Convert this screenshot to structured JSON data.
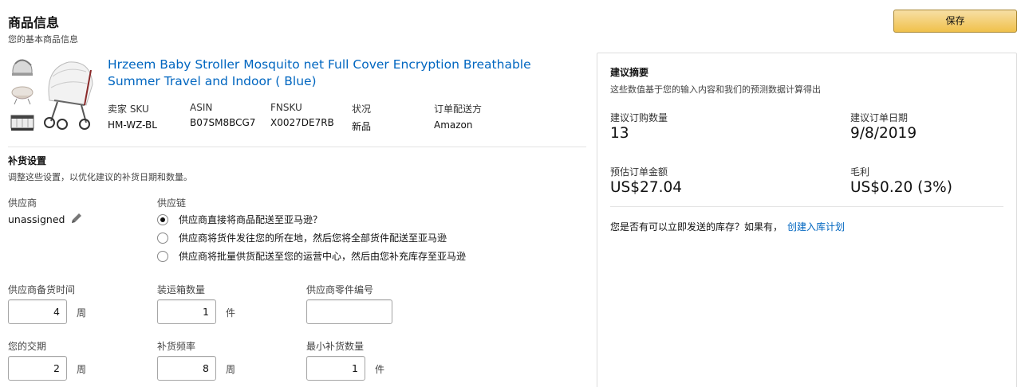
{
  "header": {
    "title": "商品信息",
    "subtitle": "您的基本商品信息",
    "save_label": "保存"
  },
  "product": {
    "title": "Hrzeem Baby Stroller Mosquito net Full Cover Encryption Breathable Summer Travel and Indoor ( Blue)",
    "meta": [
      {
        "label": "卖家 SKU",
        "value": "HM-WZ-BL"
      },
      {
        "label": "ASIN",
        "value": "B07SM8BCG7"
      },
      {
        "label": "FNSKU",
        "value": "X0027DE7RB"
      },
      {
        "label": "状况",
        "value": "新品"
      },
      {
        "label": "订单配送方",
        "value": "Amazon"
      }
    ]
  },
  "replenish": {
    "title": "补货设置",
    "subtitle": "调整这些设置，以优化建议的补货日期和数量。",
    "supplier_label": "供应商",
    "supplier_value": "unassigned",
    "chain_label": "供应链",
    "chain_options": [
      {
        "label": "供应商直接将商品配送至亚马逊？",
        "selected": true
      },
      {
        "label": "供应商将货件发往您的所在地，然后您将全部货件配送至亚马逊",
        "selected": false
      },
      {
        "label": "供应商将批量供货配送至您的运营中心，然后由您补充库存至亚马逊",
        "selected": false
      }
    ],
    "fields": {
      "lead_time": {
        "label": "供应商备货时间",
        "value": "4",
        "unit": "周"
      },
      "case_qty": {
        "label": "装运箱数量",
        "value": "1",
        "unit": "件"
      },
      "part_no": {
        "label": "供应商零件编号",
        "value": ""
      },
      "your_lead": {
        "label": "您的交期",
        "value": "2",
        "unit": "周"
      },
      "frequency": {
        "label": "补货频率",
        "value": "8",
        "unit": "周"
      },
      "min_qty": {
        "label": "最小补货数量",
        "value": "1",
        "unit": "件"
      }
    }
  },
  "summary": {
    "title": "建议摘要",
    "subtitle": "这些数值基于您的输入内容和我们的预测数据计算得出",
    "order_qty_label": "建议订购数量",
    "order_qty": "13",
    "order_date_label": "建议订单日期",
    "order_date": "9/8/2019",
    "est_amount_label": "预估订单金额",
    "est_amount": "US$27.04",
    "margin_label": "毛利",
    "margin": "US$0.20 (3%)",
    "question": "您是否有可以立即发送的库存？如果有，",
    "link": "创建入库计划"
  },
  "colors": {
    "accent_link": "#0066c0",
    "button_yellow": "#f0c14b"
  },
  "icons": [
    "pencil-icon",
    "radio-icon",
    "stroller-image"
  ]
}
